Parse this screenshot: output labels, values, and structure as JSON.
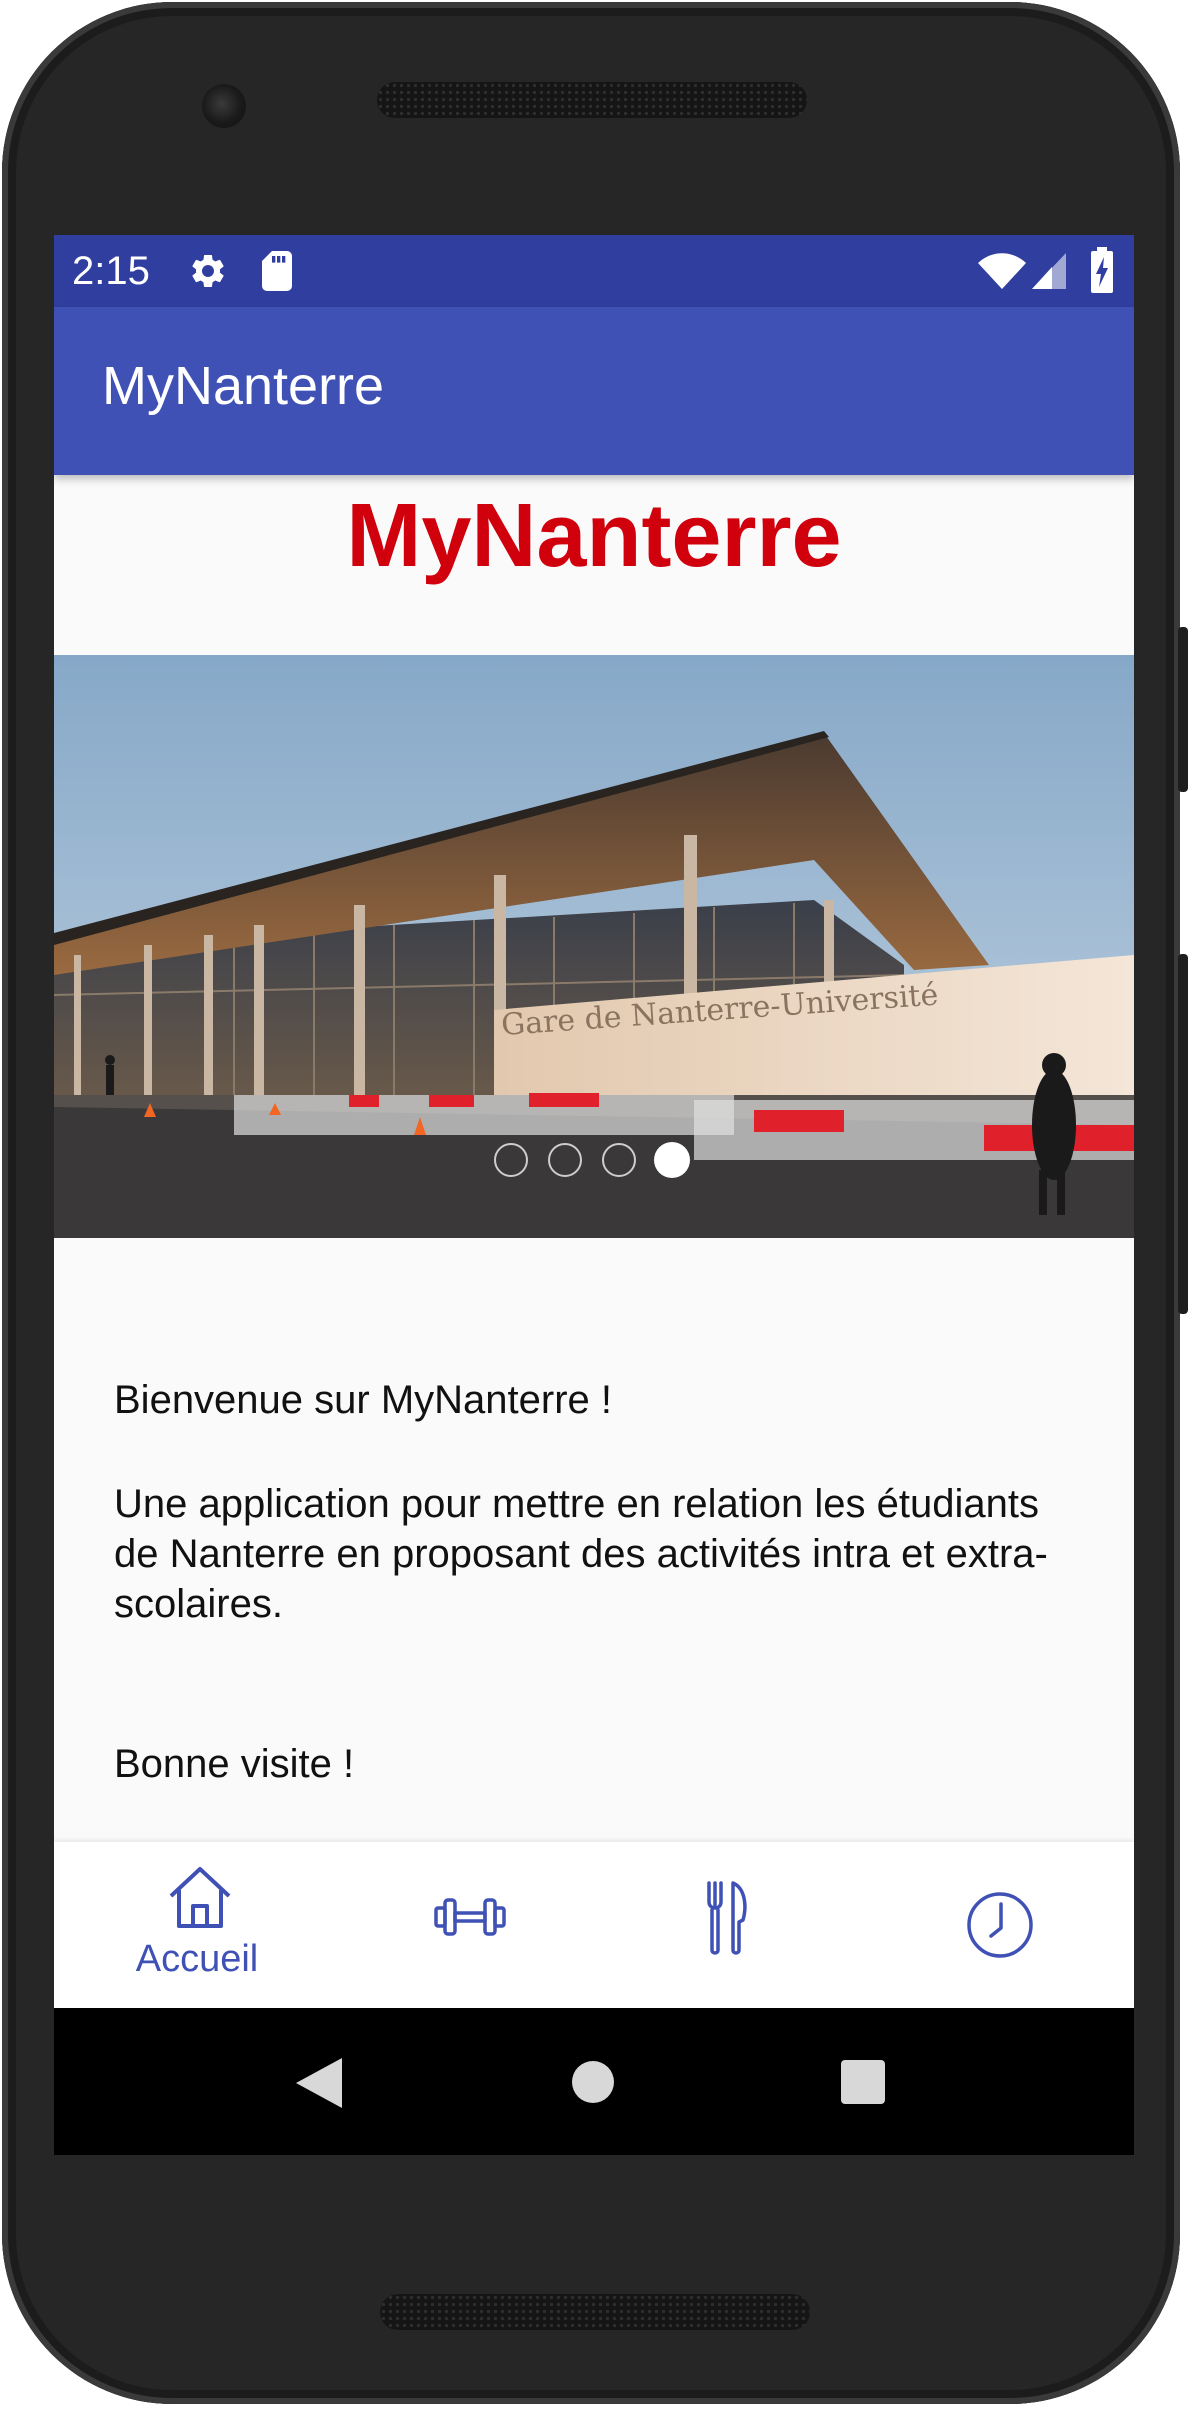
{
  "status_bar": {
    "time": "2:15",
    "icons": [
      "gear-icon",
      "sd-card-icon",
      "wifi-icon",
      "cell-signal-icon",
      "battery-charging-icon"
    ]
  },
  "app_bar": {
    "title": "MyNanterre"
  },
  "brand": {
    "title": "MyNanterre",
    "color": "#d0000d"
  },
  "carousel": {
    "image_sign_text": "Gare de Nanterre-Université",
    "page_count": 4,
    "active_index": 3
  },
  "welcome": {
    "greeting": "Bienvenue sur MyNanterre !",
    "description": "Une application pour mettre en relation les étudiants de Nanterre en proposant des activités intra et extra-scolaires.",
    "closing": "Bonne visite !"
  },
  "bottom_nav": {
    "items": [
      {
        "icon": "home-icon",
        "label": "Accueil",
        "active": true
      },
      {
        "icon": "dumbbell-icon",
        "label": "",
        "active": false
      },
      {
        "icon": "fork-knife-icon",
        "label": "",
        "active": false
      },
      {
        "icon": "clock-icon",
        "label": "",
        "active": false
      }
    ]
  },
  "system_nav": {
    "icons": [
      "back-icon",
      "home-circle-icon",
      "recents-icon"
    ]
  },
  "colors": {
    "status_bar": "#303f9f",
    "primary": "#3f51b5",
    "brand_red": "#d0000d",
    "background": "#fafafa"
  }
}
